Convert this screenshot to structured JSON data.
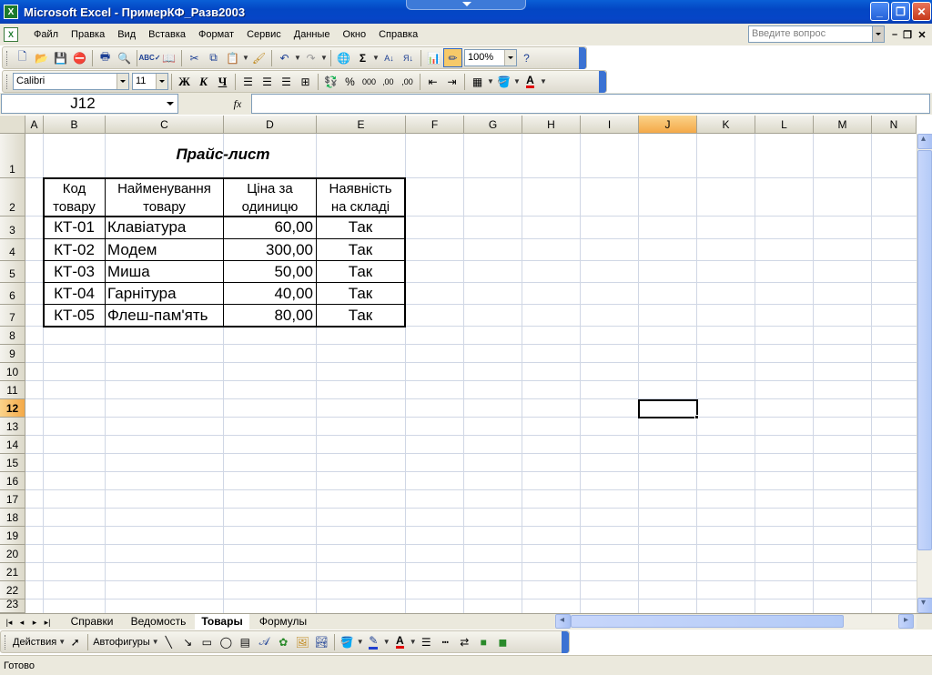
{
  "window": {
    "title": "Microsoft Excel - ПримерКФ_Разв2003",
    "app_icon": "excel-icon",
    "controls": [
      "minimize-icon",
      "restore-icon",
      "close-icon"
    ]
  },
  "menu": {
    "items": [
      "Файл",
      "Правка",
      "Вид",
      "Вставка",
      "Формат",
      "Сервис",
      "Данные",
      "Окно",
      "Справка"
    ],
    "help_placeholder": "Введите вопрос"
  },
  "standard_toolbar": {
    "zoom": "100%"
  },
  "format_toolbar": {
    "font": "Calibri",
    "size": "11",
    "bold": "Ж",
    "italic": "К",
    "underline": "Ч",
    "percent": "%",
    "thousands": "000",
    "inc_decimal": "‚00",
    "dec_decimal": ",00"
  },
  "formula_bar": {
    "name_box": "J12",
    "fx": "fx",
    "formula": ""
  },
  "grid": {
    "columns": [
      "A",
      "B",
      "C",
      "D",
      "E",
      "F",
      "G",
      "H",
      "I",
      "J",
      "K",
      "L",
      "M",
      "N"
    ],
    "selected_column": "J",
    "rows": [
      "1",
      "2",
      "3",
      "4",
      "5",
      "6",
      "7",
      "8",
      "9",
      "10",
      "11",
      "12",
      "13",
      "14",
      "15",
      "16",
      "17",
      "18",
      "19",
      "20",
      "21",
      "22",
      "23"
    ],
    "selected_row": "12"
  },
  "sheet": {
    "title": "Прайс-лист",
    "headers": {
      "code": [
        "Код",
        "товару"
      ],
      "name": [
        "Найменування",
        "товару"
      ],
      "price": [
        "Ціна за",
        "одиницю"
      ],
      "stock": [
        "Наявність",
        "на складі"
      ]
    },
    "rows": [
      {
        "code": "КТ-01",
        "name": "Клавіатура",
        "price": "60,00",
        "stock": "Так"
      },
      {
        "code": "КТ-02",
        "name": "Модем",
        "price": "300,00",
        "stock": "Так"
      },
      {
        "code": "КТ-03",
        "name": "Миша",
        "price": "50,00",
        "stock": "Так"
      },
      {
        "code": "КТ-04",
        "name": "Гарнітура",
        "price": "40,00",
        "stock": "Так"
      },
      {
        "code": "КТ-05",
        "name": "Флеш-пам'ять",
        "price": "80,00",
        "stock": "Так"
      }
    ]
  },
  "sheet_tabs": [
    "Справки",
    "Ведомость",
    "Товары",
    "Формулы"
  ],
  "active_tab": "Товары",
  "drawing_toolbar": {
    "actions": "Действия",
    "autoshapes": "Автофигуры"
  },
  "status": {
    "text": "Готово"
  },
  "colors": {
    "title_bar": "#0346c4",
    "selected_header": "#f4a948",
    "grid_line": "#d0d7e5"
  }
}
